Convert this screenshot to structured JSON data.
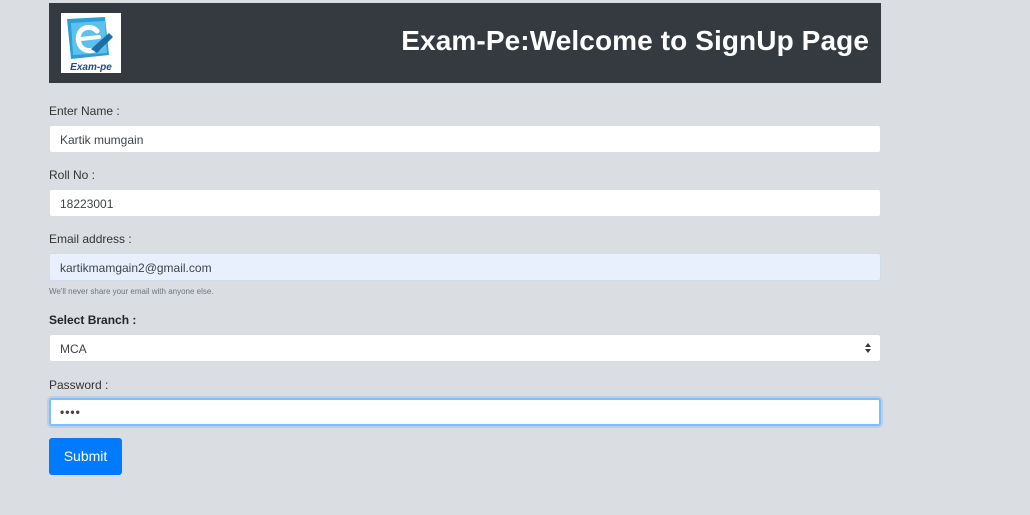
{
  "header": {
    "logo_text": "Exam-pe",
    "title": "Exam-Pe:Welcome to SignUp Page"
  },
  "form": {
    "name": {
      "label": "Enter Name :",
      "value": "Kartik mumgain"
    },
    "roll": {
      "label": "Roll No :",
      "value": "18223001"
    },
    "email": {
      "label": "Email address :",
      "value": "kartikmamgain2@gmail.com",
      "help": "We'll never share your email with anyone else."
    },
    "branch": {
      "label": "Select Branch :",
      "selected": "MCA"
    },
    "password": {
      "label": "Password :",
      "value": "••••"
    },
    "submit_label": "Submit"
  },
  "colors": {
    "header_bg": "#343a40",
    "page_bg": "#dadee2",
    "submit_bg": "#007bff",
    "autofill_bg": "#e8f0fe",
    "focus_border": "#80bdff"
  },
  "icons": {
    "logo": "exam-pe-logo-icon",
    "select": "select-updown-arrow-icon"
  }
}
